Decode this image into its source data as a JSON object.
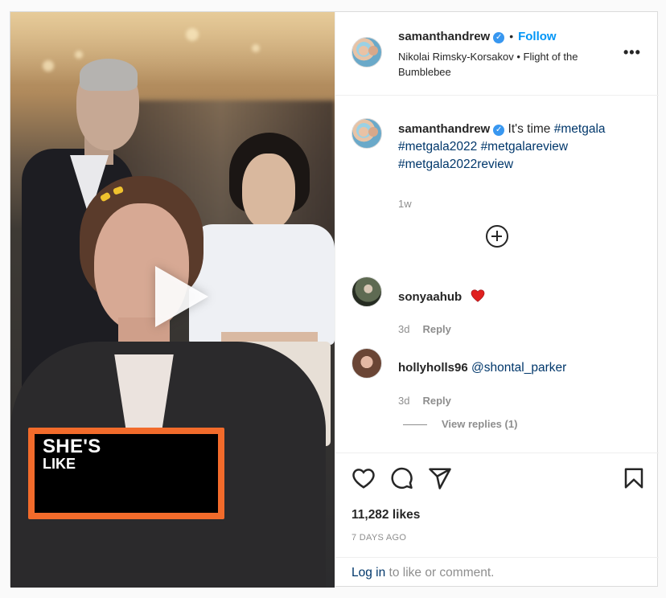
{
  "post": {
    "author": "samanthandrew",
    "follow_label": "Follow",
    "separator": "•",
    "audio": "Nikolai Rimsky-Korsakov • Flight of the Bumblebee",
    "caption_prefix": "It's time",
    "hashtags": [
      "#metgala",
      "#metgala2022",
      "#metgalareview",
      "#metgala2022review"
    ],
    "caption_age": "1w"
  },
  "video": {
    "overlay_line1": "SHE'S",
    "overlay_line2": "LIKE"
  },
  "comments": [
    {
      "user": "sonyaahub",
      "text": "",
      "emoji": "heart",
      "age": "3d",
      "reply_label": "Reply"
    },
    {
      "user": "hollyholls96",
      "text": "@shontal_parker",
      "age": "3d",
      "reply_label": "Reply",
      "view_replies": "View replies (1)"
    }
  ],
  "stats": {
    "likes": "11,282 likes",
    "posted": "7 DAYS AGO"
  },
  "login": {
    "link": "Log in",
    "rest": " to like or comment."
  },
  "colors": {
    "accent": "#0095f6",
    "hashtag": "#00376b",
    "caption_border": "#f26b2b",
    "heart": "#ed4956"
  }
}
